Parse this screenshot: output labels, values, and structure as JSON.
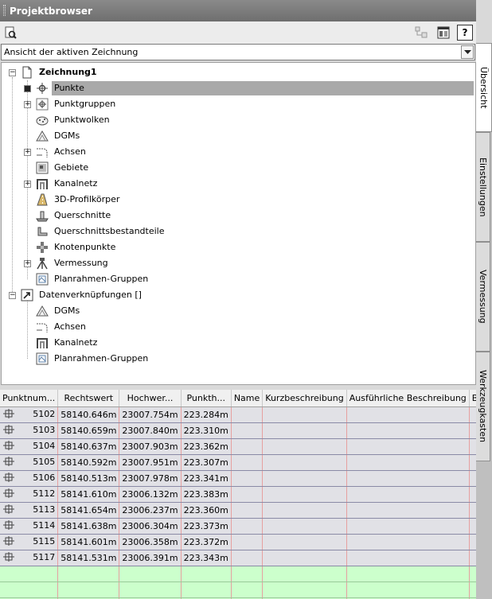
{
  "window": {
    "title": "Projektbrowser"
  },
  "view_combo": {
    "value": "Ansicht der aktiven Zeichnung"
  },
  "tree": {
    "root": "Zeichnung1",
    "children": [
      "Punkte",
      "Punktgruppen",
      "Punktwolken",
      "DGMs",
      "Achsen",
      "Gebiete",
      "Kanalnetz",
      "3D-Profilkörper",
      "Querschnitte",
      "Querschnittsbestandteile",
      "Knotenpunkte",
      "Vermessung",
      "Planrahmen-Gruppen"
    ],
    "data_refs": "Datenverknüpfungen []",
    "data_ref_children": [
      "DGMs",
      "Achsen",
      "Kanalnetz",
      "Planrahmen-Gruppen"
    ]
  },
  "grid": {
    "headers": [
      "Punktnum...",
      "Rechtswert",
      "Hochwer...",
      "Punkth...",
      "Name",
      "Kurzbeschreibung",
      "Ausführliche Beschreibung",
      "B"
    ],
    "rows": [
      [
        "5102",
        "58140.646m",
        "23007.754m",
        "223.284m"
      ],
      [
        "5103",
        "58140.659m",
        "23007.840m",
        "223.310m"
      ],
      [
        "5104",
        "58140.637m",
        "23007.903m",
        "223.362m"
      ],
      [
        "5105",
        "58140.592m",
        "23007.951m",
        "223.307m"
      ],
      [
        "5106",
        "58140.513m",
        "23007.978m",
        "223.341m"
      ],
      [
        "5112",
        "58141.610m",
        "23006.132m",
        "223.383m"
      ],
      [
        "5113",
        "58141.654m",
        "23006.237m",
        "223.360m"
      ],
      [
        "5114",
        "58141.638m",
        "23006.304m",
        "223.373m"
      ],
      [
        "5115",
        "58141.601m",
        "23006.358m",
        "223.372m"
      ],
      [
        "5117",
        "58141.531m",
        "23006.391m",
        "223.343m"
      ]
    ]
  },
  "tabs": [
    "Übersicht",
    "Einstellungen",
    "Vermessung",
    "Werkzeugkasten"
  ]
}
